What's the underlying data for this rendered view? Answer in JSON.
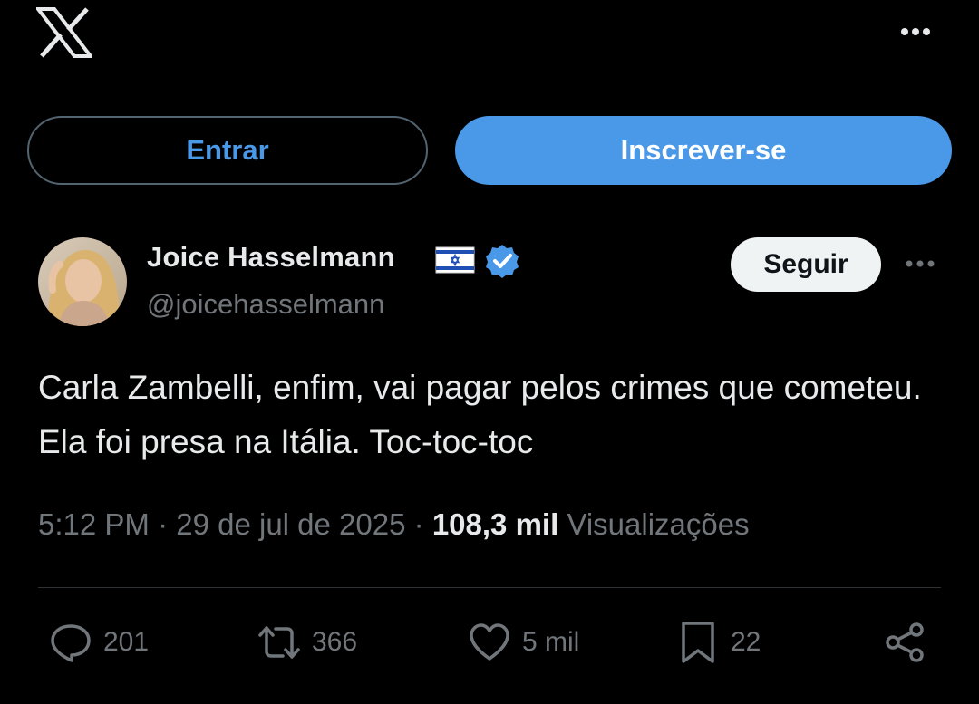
{
  "header": {
    "logo_icon": "x-logo-icon",
    "more_icon": "more-horizontal-icon"
  },
  "auth": {
    "login_label": "Entrar",
    "signup_label": "Inscrever-se"
  },
  "author": {
    "display_name": "Joice Hasselmann",
    "flag_icon": "israel-flag-icon",
    "verified_icon": "verified-badge-icon",
    "handle": "@joicehasselmann",
    "follow_label": "Seguir"
  },
  "tweet": {
    "text": "Carla Zambelli, enfim, vai pagar pelos crimes que cometeu. Ela foi presa na Itália. Toc-toc-toc",
    "time": "5:12 PM",
    "date": "29 de jul de 2025",
    "views_count": "108,3 mil",
    "views_label": "Visualizações"
  },
  "actions": {
    "replies": "201",
    "retweets": "366",
    "likes": "5 mil",
    "bookmarks": "22"
  },
  "colors": {
    "background": "#000000",
    "accent": "#4a99e9",
    "text": "#e7e9ea",
    "muted": "#71767b",
    "divider": "#2f3336"
  }
}
